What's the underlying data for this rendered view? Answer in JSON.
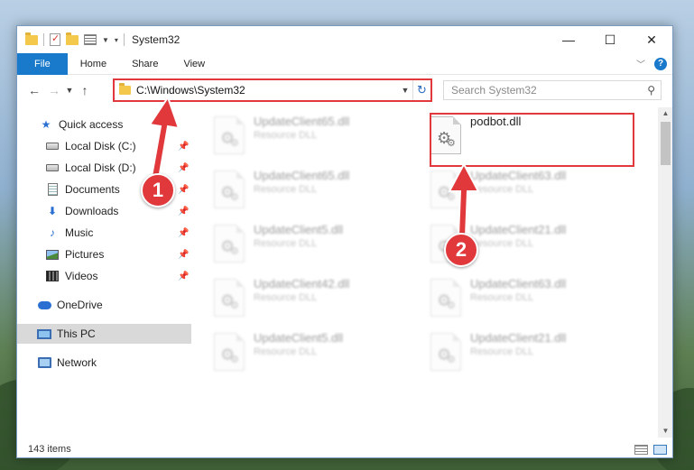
{
  "window": {
    "title": "System32",
    "controls": {
      "minimize": "—",
      "maximize": "☐",
      "close": "✕"
    }
  },
  "ribbon": {
    "tabs": [
      "File",
      "Home",
      "Share",
      "View"
    ],
    "collapse": "﹀",
    "help": "?"
  },
  "address": {
    "path": "C:\\Windows\\System32",
    "search_placeholder": "Search System32"
  },
  "nav": {
    "quick_access": "Quick access",
    "items": [
      "Local Disk (C:)",
      "Local Disk (D:)",
      "Documents",
      "Downloads",
      "Music",
      "Pictures",
      "Videos"
    ],
    "onedrive": "OneDrive",
    "this_pc": "This PC",
    "network": "Network"
  },
  "files": [
    {
      "name": "UpdateClient65.dll",
      "type": "Resource DLL"
    },
    {
      "name": "podbot.dll",
      "type": ""
    },
    {
      "name": "UpdateClient65.dll",
      "type": "Resource DLL"
    },
    {
      "name": "UpdateClient63.dll",
      "type": "Resource DLL"
    },
    {
      "name": "UpdateClient5.dll",
      "type": "Resource DLL"
    },
    {
      "name": "UpdateClient21.dll",
      "type": "Resource DLL"
    },
    {
      "name": "UpdateClient42.dll",
      "type": "Resource DLL"
    },
    {
      "name": "UpdateClient63.dll",
      "type": "Resource DLL"
    },
    {
      "name": "UpdateClient5.dll",
      "type": "Resource DLL"
    },
    {
      "name": "UpdateClient21.dll",
      "type": "Resource DLL"
    }
  ],
  "status": {
    "count": "143 items"
  },
  "annotations": {
    "step1": "1",
    "step2": "2"
  },
  "colors": {
    "accent": "#1979ca",
    "highlight": "#e0383b"
  }
}
